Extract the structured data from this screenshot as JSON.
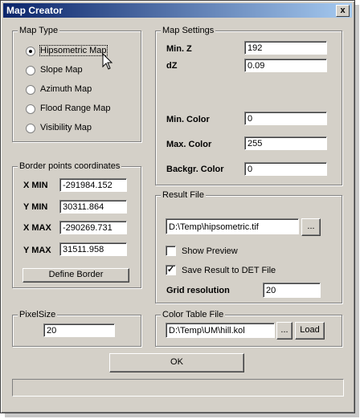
{
  "window": {
    "title": "Map Creator",
    "close_label": "x"
  },
  "map_type": {
    "title": "Map Type",
    "options": [
      {
        "label": "Hipsometric Map",
        "selected": true
      },
      {
        "label": "Slope Map",
        "selected": false
      },
      {
        "label": "Azimuth Map",
        "selected": false
      },
      {
        "label": "Flood Range Map",
        "selected": false
      },
      {
        "label": "Visibility Map",
        "selected": false
      }
    ]
  },
  "map_settings": {
    "title": "Map Settings",
    "min_z_label": "Min. Z",
    "min_z_value": "192",
    "dz_label": "dZ",
    "dz_value": "0.09",
    "min_color_label": "Min. Color",
    "min_color_value": "0",
    "max_color_label": "Max. Color",
    "max_color_value": "255",
    "backgr_color_label": "Backgr. Color",
    "backgr_color_value": "0"
  },
  "border": {
    "title": "Border points coordinates",
    "xmin_label": "X MIN",
    "xmin_value": "-291984.152",
    "ymin_label": "Y MIN",
    "ymin_value": "30311.864",
    "xmax_label": "X MAX",
    "xmax_value": "-290269.731",
    "ymax_label": "Y MAX",
    "ymax_value": "31511.958",
    "define_label": "Define Border"
  },
  "result_file": {
    "title": "Result File",
    "path": "D:\\Temp\\hipsometric.tif",
    "browse_label": "...",
    "show_preview_label": "Show Preview",
    "show_preview_checked": false,
    "save_det_label": "Save Result to DET File",
    "save_det_checked": true,
    "grid_label": "Grid resolution",
    "grid_value": "20"
  },
  "pixel_size": {
    "title": "PixelSize",
    "value": "20"
  },
  "color_table": {
    "title": "Color Table File",
    "path": "D:\\Temp\\UM\\hill.kol",
    "browse_label": "...",
    "load_label": "Load"
  },
  "ok_label": "OK",
  "check_mark": "✓",
  "colors": {
    "title_start": "#0a246a",
    "title_end": "#a6caf0",
    "face": "#d4d0c8"
  }
}
